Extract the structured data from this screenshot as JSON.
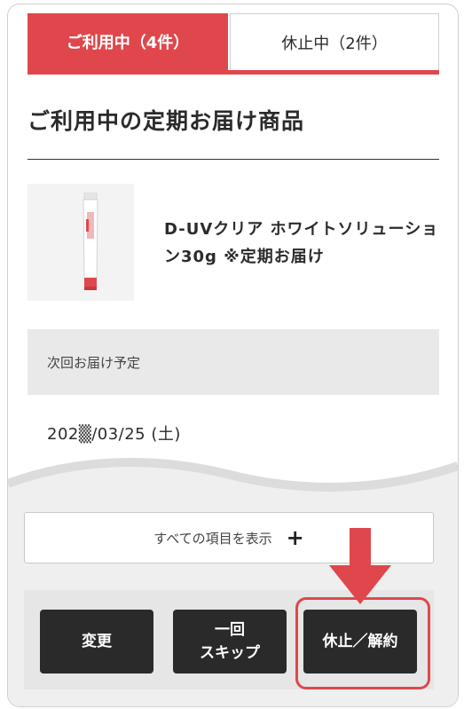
{
  "tabs": [
    {
      "label": "ご利用中（4件）",
      "active": true
    },
    {
      "label": "休止中（2件）",
      "active": false
    }
  ],
  "section_title": "ご利用中の定期お届け商品",
  "product": {
    "name": "D-UVクリア ホワイトソリューション30g ※定期お届け",
    "image_icon": "product-tube-image"
  },
  "next_delivery": {
    "label": "次回お届け予定",
    "date": "202▒/03/25 (土)"
  },
  "show_all": {
    "label": "すべての項目を表示",
    "icon": "plus-icon"
  },
  "actions": {
    "change": "変更",
    "skip_line1": "一回",
    "skip_line2": "スキップ",
    "suspend": "休止／解約"
  },
  "colors": {
    "accent": "#e0474c",
    "button": "#2a2a2a",
    "panel": "#e9e9e9"
  }
}
